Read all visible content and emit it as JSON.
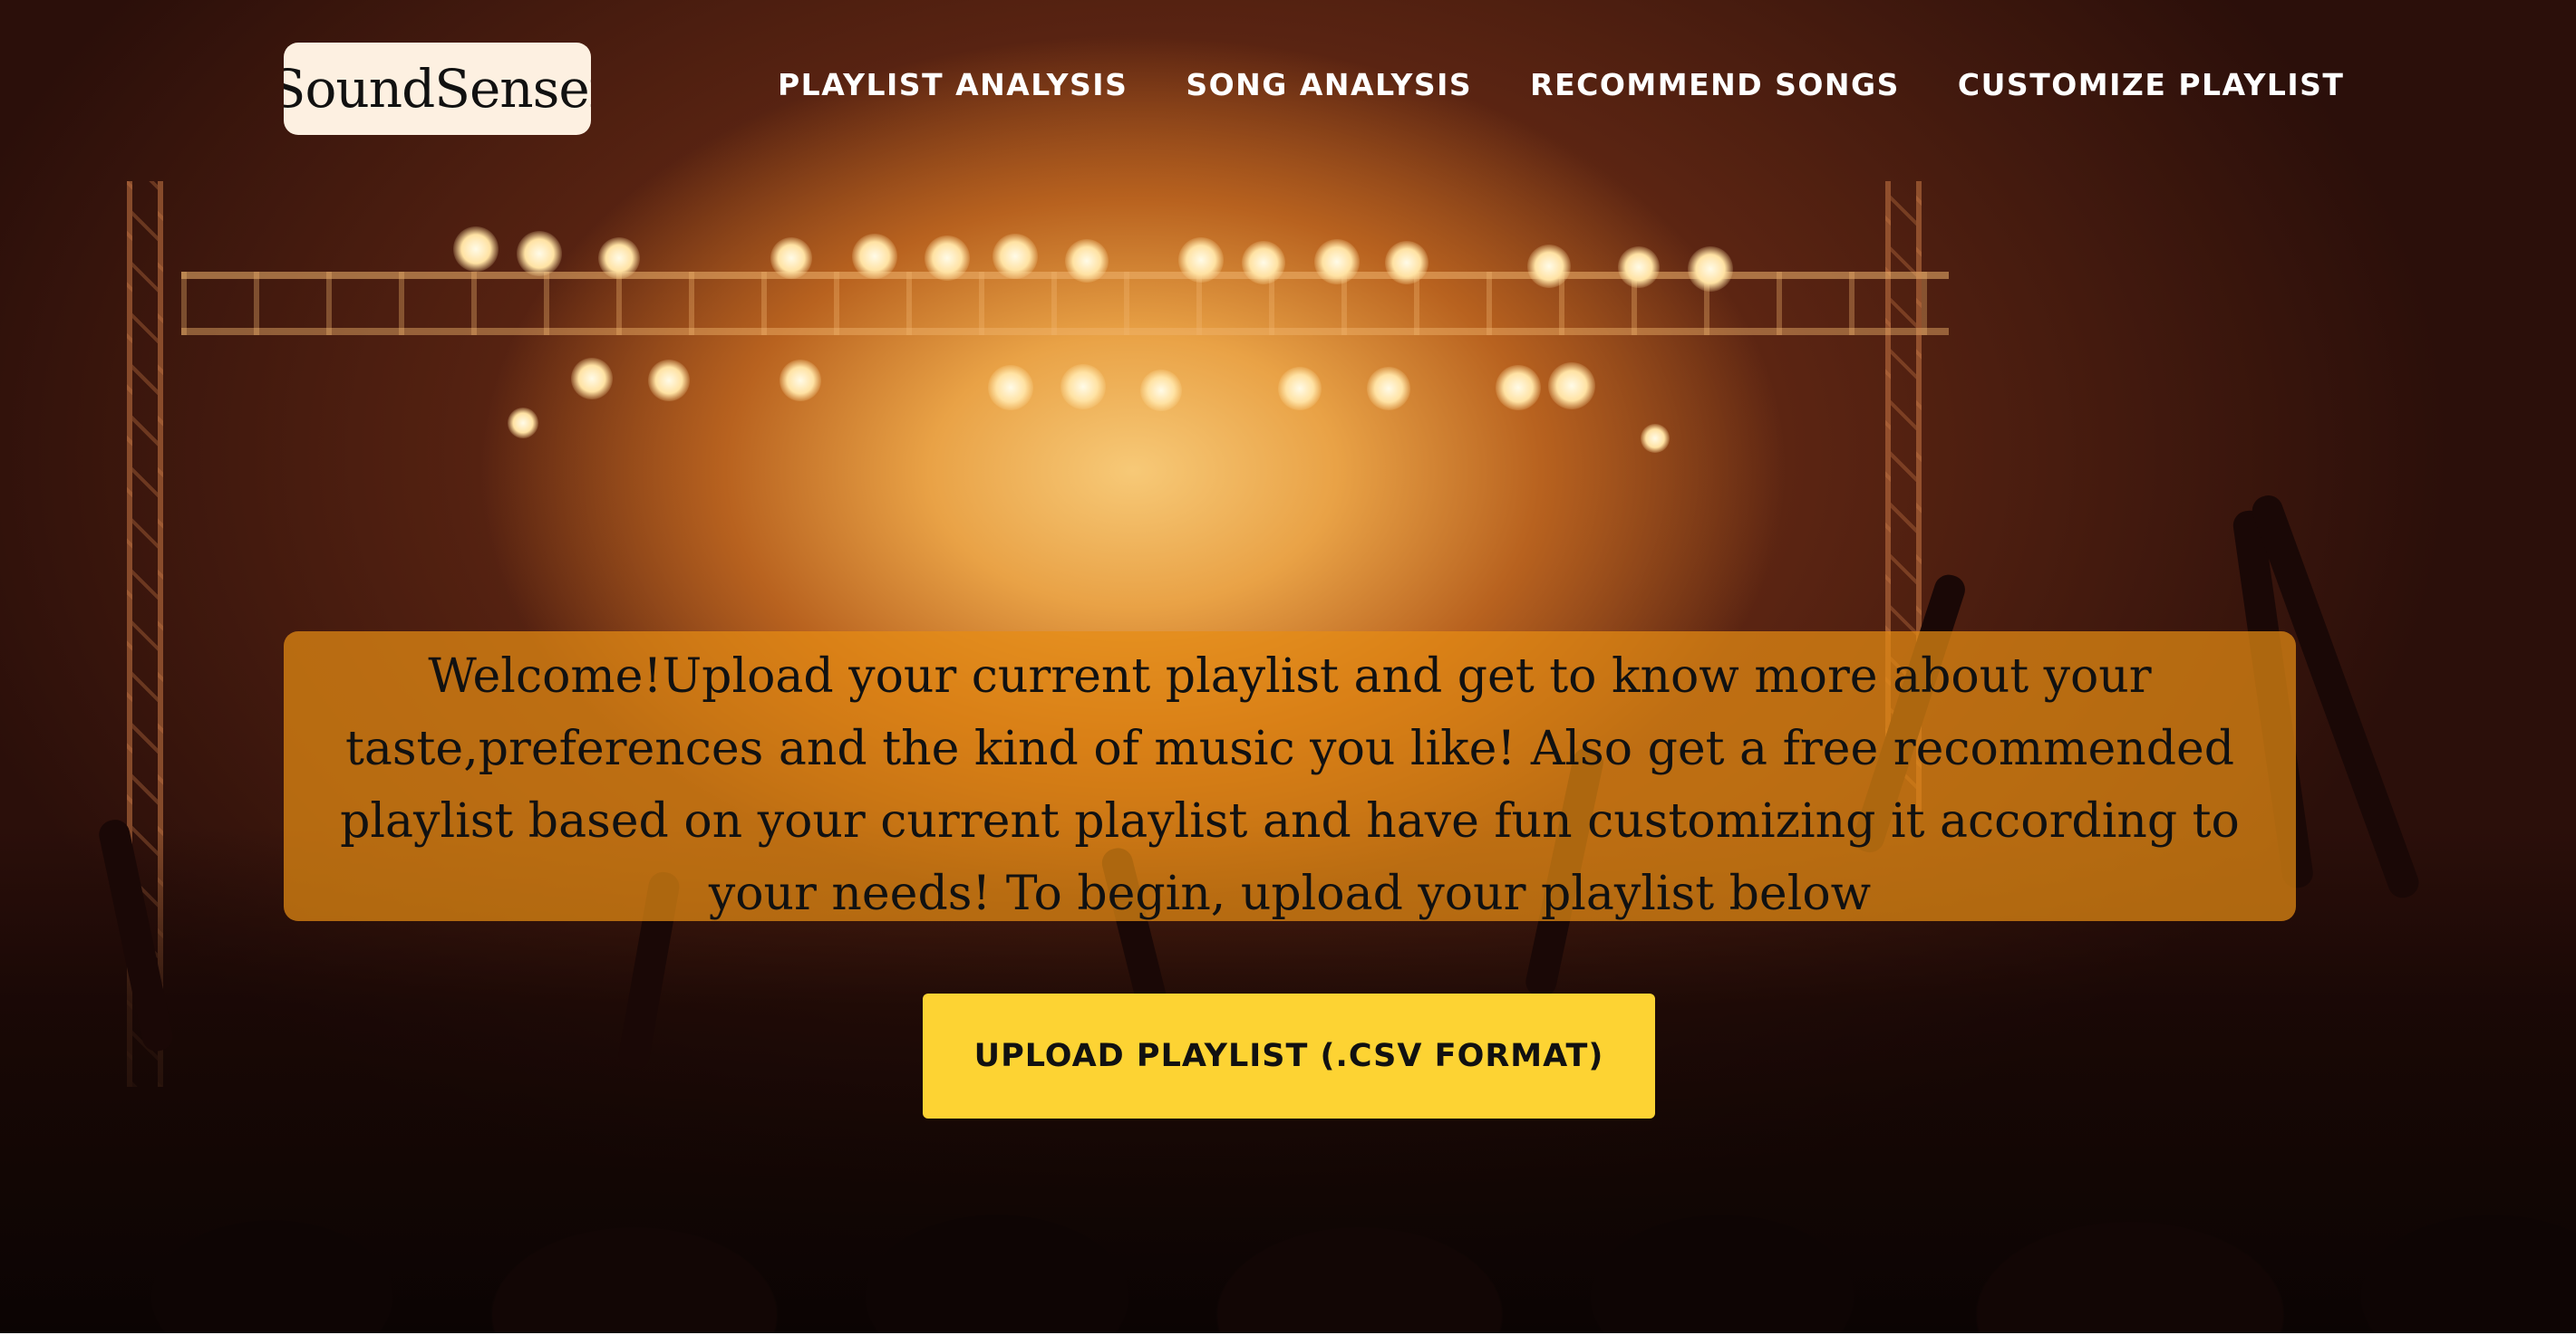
{
  "brand": {
    "logo_text": "SoundSensei"
  },
  "nav": {
    "items": [
      {
        "label": "PLAYLIST ANALYSIS"
      },
      {
        "label": "SONG ANALYSIS"
      },
      {
        "label": "RECOMMEND SONGS"
      },
      {
        "label": "CUSTOMIZE PLAYLIST"
      }
    ]
  },
  "hero": {
    "background_image": "concert-crowd-stage-lights",
    "welcome_text": "Welcome!Upload your current playlist and get to know more about your taste,preferences and the kind of music you like! Also get a free recommended playlist based on your current playlist and have fun customizing it according to your needs! To begin, upload your playlist below",
    "upload_button_label": "UPLOAD PLAYLIST (.CSV FORMAT)"
  },
  "colors": {
    "accent_button": "#fdd333",
    "welcome_box": "#e68c14",
    "logo_bg": "#fdf0e1",
    "nav_text": "#ffffff"
  }
}
